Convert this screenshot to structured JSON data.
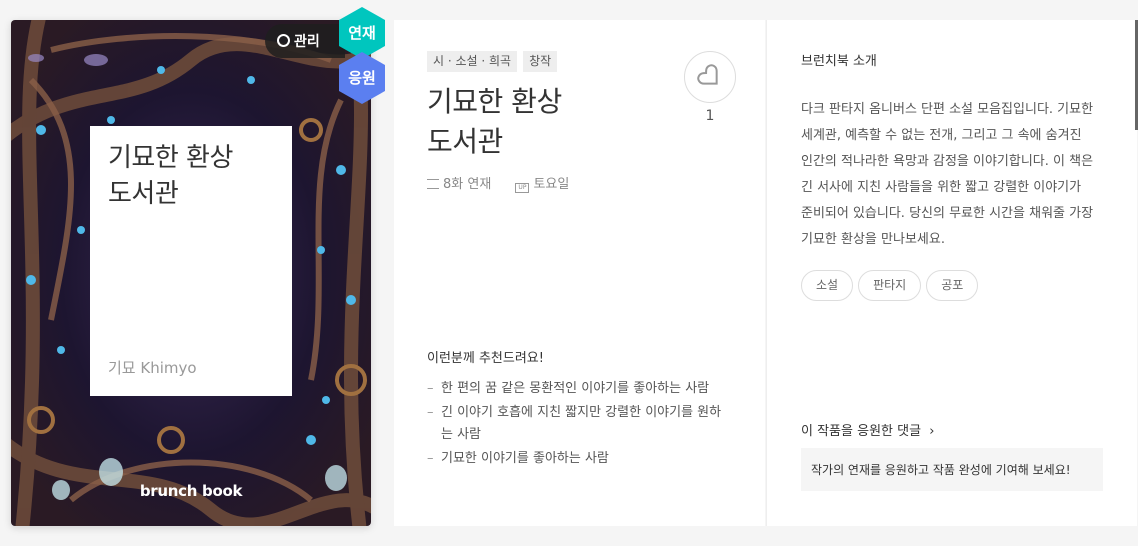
{
  "cover": {
    "manage_label": "관리",
    "serial_badge": "연재",
    "support_badge": "응원",
    "title": "기묘한 환상\n도서관",
    "author": "기묘 Khimyo",
    "logo": "brunch book"
  },
  "book": {
    "tags": [
      "시 · 소설 · 희곡",
      "창작"
    ],
    "title": "기묘한 환상\n도서관",
    "episodes": "8화 연재",
    "update_day": "토요일",
    "update_icon_text": "UP",
    "like_count": "1",
    "recommend_title": "이런분께 추천드려요!",
    "recommend_items": [
      "한 편의 꿈 같은 몽환적인 이야기를 좋아하는 사람",
      "긴 이야기 호흡에 지친 짧지만 강렬한 이야기를 원하는 사람",
      "기묘한 이야기를 좋아하는 사람"
    ]
  },
  "intro": {
    "title": "브런치북 소개",
    "text": "다크 판타지 옴니버스 단편 소설 모음집입니다. 기묘한 세계관, 예측할 수 없는 전개, 그리고 그 속에 숨겨진 인간의 적나라한 욕망과 감정을 이야기합니다. 이 책은 긴 서사에 지친 사람들을 위한 짧고 강렬한 이야기가 준비되어 있습니다. 당신의 무료한 시간을 채워줄 가장 기묘한 환상을 만나보세요.",
    "keywords": [
      "소설",
      "판타지",
      "공포"
    ],
    "comments_link": "이 작품을 응원한 댓글",
    "comments_prompt": "작가의 연재를 응원하고 작품 완성에 기여해 보세요!"
  },
  "colors": {
    "serial_badge": "#00c6be",
    "support_badge": "#5b7ff0"
  }
}
